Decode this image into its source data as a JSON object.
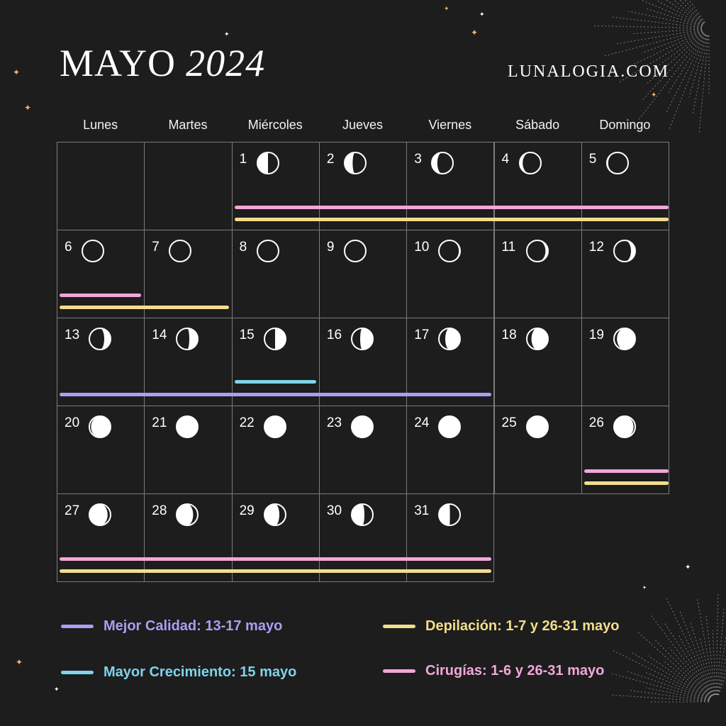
{
  "header": {
    "month": "MAYO",
    "year": "2024",
    "site": "LUNALOGIA.COM"
  },
  "weekdays": [
    "Lunes",
    "Martes",
    "Miércoles",
    "Jueves",
    "Viernes",
    "Sábado",
    "Domingo"
  ],
  "colors": {
    "background": "#1d1d1d",
    "grid_line": "#7c7c7c",
    "purple": "#a99ff2",
    "blue": "#7fd3ec",
    "yellow": "#f2dd8c",
    "pink": "#f2a6d9",
    "star_gold": "#e9b96b"
  },
  "days": [
    {
      "day": "1",
      "phase": "waning-third-quarter",
      "illumination": 0.5
    },
    {
      "day": "2",
      "phase": "waning-crescent",
      "illumination": 0.38
    },
    {
      "day": "3",
      "phase": "waning-crescent",
      "illumination": 0.26
    },
    {
      "day": "4",
      "phase": "waning-crescent",
      "illumination": 0.14
    },
    {
      "day": "5",
      "phase": "waning-crescent",
      "illumination": 0.06
    },
    {
      "day": "6",
      "phase": "waning-crescent",
      "illumination": 0.02
    },
    {
      "day": "7",
      "phase": "waning-crescent",
      "illumination": 0.01
    },
    {
      "day": "8",
      "phase": "new-moon",
      "illumination": 0.0
    },
    {
      "day": "9",
      "phase": "waxing-crescent",
      "illumination": 0.02
    },
    {
      "day": "10",
      "phase": "waxing-crescent",
      "illumination": 0.06
    },
    {
      "day": "11",
      "phase": "waxing-crescent",
      "illumination": 0.12
    },
    {
      "day": "12",
      "phase": "waxing-crescent",
      "illumination": 0.2
    },
    {
      "day": "13",
      "phase": "waxing-crescent",
      "illumination": 0.3
    },
    {
      "day": "14",
      "phase": "waxing-crescent",
      "illumination": 0.4
    },
    {
      "day": "15",
      "phase": "first-quarter",
      "illumination": 0.5
    },
    {
      "day": "16",
      "phase": "waxing-gibbous",
      "illumination": 0.6
    },
    {
      "day": "17",
      "phase": "waxing-gibbous",
      "illumination": 0.7
    },
    {
      "day": "18",
      "phase": "waxing-gibbous",
      "illumination": 0.78
    },
    {
      "day": "19",
      "phase": "waxing-gibbous",
      "illumination": 0.86
    },
    {
      "day": "20",
      "phase": "waxing-gibbous",
      "illumination": 0.92
    },
    {
      "day": "21",
      "phase": "waxing-gibbous",
      "illumination": 0.97
    },
    {
      "day": "22",
      "phase": "full-moon",
      "illumination": 0.99
    },
    {
      "day": "23",
      "phase": "full-moon",
      "illumination": 1.0
    },
    {
      "day": "24",
      "phase": "full-moon",
      "illumination": 0.99
    },
    {
      "day": "25",
      "phase": "waning-gibbous",
      "illumination": 0.97
    },
    {
      "day": "26",
      "phase": "waning-gibbous",
      "illumination": 0.92
    },
    {
      "day": "27",
      "phase": "waning-gibbous",
      "illumination": 0.86
    },
    {
      "day": "28",
      "phase": "waning-gibbous",
      "illumination": 0.78
    },
    {
      "day": "29",
      "phase": "waning-gibbous",
      "illumination": 0.7
    },
    {
      "day": "30",
      "phase": "waning-gibbous",
      "illumination": 0.6
    },
    {
      "day": "31",
      "phase": "waning-gibbous",
      "illumination": 0.52
    }
  ],
  "ranges": [
    {
      "category": "surgery",
      "color": "pink",
      "from": 1,
      "to": 6
    },
    {
      "category": "hair-removal",
      "color": "yellow",
      "from": 1,
      "to": 7
    },
    {
      "category": "best-quality",
      "color": "purple",
      "from": 13,
      "to": 17
    },
    {
      "category": "greatest-growth",
      "color": "blue",
      "from": 15,
      "to": 15
    },
    {
      "category": "surgery",
      "color": "pink",
      "from": 26,
      "to": 31
    },
    {
      "category": "hair-removal",
      "color": "yellow",
      "from": 26,
      "to": 31
    }
  ],
  "legend": [
    {
      "label": "Mejor Calidad: 13-17 mayo",
      "color": "#a99ff2"
    },
    {
      "label": "Mayor Crecimiento: 15 mayo",
      "color": "#7fd3ec"
    },
    {
      "label": "Depilación: 1-7 y 26-31 mayo",
      "color": "#f2dd8c"
    },
    {
      "label": "Cirugías: 1-6 y 26-31 mayo",
      "color": "#f2a6d9"
    }
  ]
}
